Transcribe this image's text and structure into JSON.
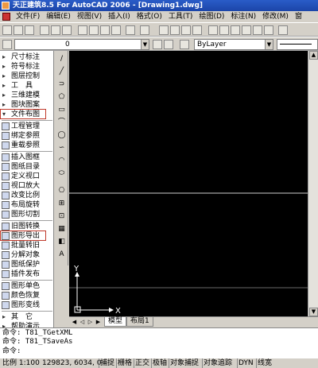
{
  "window": {
    "title": "天正建筑8.5 For AutoCAD 2006 - [Drawing1.dwg]"
  },
  "menu": [
    "文件(F)",
    "编辑(E)",
    "视图(V)",
    "插入(I)",
    "格式(O)",
    "工具(T)",
    "绘图(D)",
    "标注(N)",
    "修改(M)",
    "窗"
  ],
  "toolbar": {
    "layer_value": "0",
    "linetype_value": "ByLayer"
  },
  "side_menu": {
    "items": [
      {
        "mark": "▸",
        "label": "尺寸标注"
      },
      {
        "mark": "▸",
        "label": "符号标注"
      },
      {
        "mark": "▸",
        "label": "图层控制"
      },
      {
        "mark": "▸",
        "label": "工　具"
      },
      {
        "mark": "▸",
        "label": "三维建模"
      },
      {
        "mark": "▸",
        "label": "图块图案"
      },
      {
        "mark": "▾",
        "label": "文件布图"
      },
      {
        "mark": "",
        "label": "工程管理"
      },
      {
        "mark": "",
        "label": "绑定参照"
      },
      {
        "mark": "",
        "label": "重载参照"
      },
      {
        "mark": "",
        "label": "插入图框"
      },
      {
        "mark": "",
        "label": "图纸目录"
      },
      {
        "mark": "",
        "label": "定义视口"
      },
      {
        "mark": "",
        "label": "视口放大"
      },
      {
        "mark": "",
        "label": "改变比例"
      },
      {
        "mark": "",
        "label": "布局旋转"
      },
      {
        "mark": "",
        "label": "图形切割"
      },
      {
        "mark": "",
        "label": "旧图转换"
      },
      {
        "mark": "",
        "label": "图形导出"
      },
      {
        "mark": "",
        "label": "批量转旧"
      },
      {
        "mark": "",
        "label": "分解对象"
      },
      {
        "mark": "",
        "label": "图纸保护"
      },
      {
        "mark": "",
        "label": "插件发布"
      },
      {
        "mark": "",
        "label": "图形单色"
      },
      {
        "mark": "",
        "label": "颜色恢复"
      },
      {
        "mark": "",
        "label": "图形变线"
      },
      {
        "mark": "▸",
        "label": "其　它"
      },
      {
        "mark": "▸",
        "label": "帮助演示"
      }
    ]
  },
  "draw_tools": [
    "/",
    "╱",
    "⊃",
    "⬠",
    "▭",
    "⌒",
    "◯",
    "∽",
    "◠",
    "⬭",
    "⎔",
    "⊞",
    "⊡",
    "▦",
    "◧",
    "A"
  ],
  "axis": {
    "y_label": "Y",
    "x_label": "X"
  },
  "tabs": {
    "model": "模型",
    "layout1": "布局1"
  },
  "command": {
    "lines": [
      "命令: T81_TGetXML",
      "命令: T81_TSaveAs",
      "命令:"
    ]
  },
  "status": {
    "scale": "比例 1:100",
    "coords": "129823, 6034, 0",
    "toggles": [
      "捕捉",
      "栅格",
      "正交",
      "极轴",
      "对象捕捉",
      "对象追踪",
      "DYN",
      "线宽"
    ]
  }
}
